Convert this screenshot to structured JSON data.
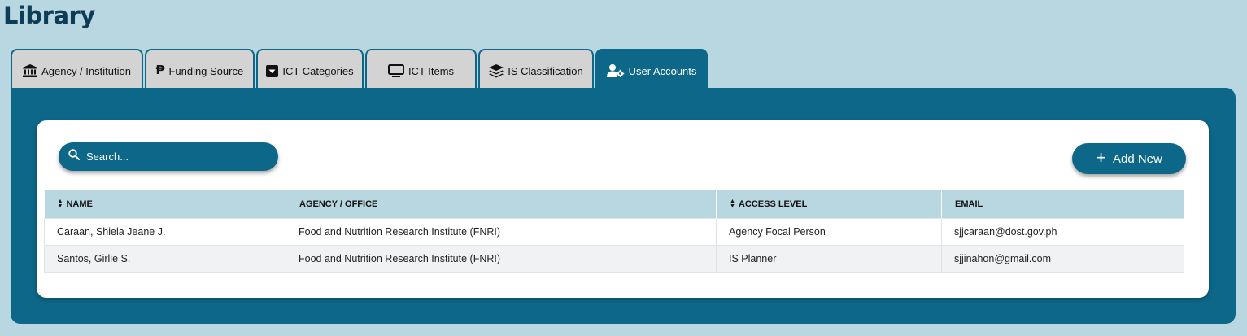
{
  "page": {
    "title": "Library"
  },
  "tabs": [
    {
      "label": "Agency / Institution",
      "icon": "bank-icon"
    },
    {
      "label": "Funding Source",
      "icon": "peso-icon"
    },
    {
      "label": "ICT Categories",
      "icon": "dropdown-box-icon"
    },
    {
      "label": "ICT Items",
      "icon": "monitor-icon"
    },
    {
      "label": "IS Classification",
      "icon": "layers-icon"
    },
    {
      "label": "User Accounts",
      "icon": "user-gear-icon",
      "active": true
    }
  ],
  "search": {
    "placeholder": "Search..."
  },
  "toolbar": {
    "add_label": "Add New"
  },
  "table": {
    "columns": [
      "NAME",
      "AGENCY / OFFICE",
      "ACCESS LEVEL",
      "EMAIL"
    ],
    "rows": [
      {
        "name": "Caraan, Shiela Jeane J.",
        "agency": "Food and Nutrition Research Institute (FNRI)",
        "access": "Agency Focal Person",
        "email": "sjjcaraan@dost.gov.ph"
      },
      {
        "name": "Santos, Girlie S.",
        "agency": "Food and Nutrition Research Institute (FNRI)",
        "access": "IS Planner",
        "email": "sjjinahon@gmail.com"
      }
    ]
  },
  "colors": {
    "background": "#b9d7e1",
    "accent": "#0d6789",
    "title": "#0d3d56",
    "tab_inactive": "#d3d3d3"
  }
}
